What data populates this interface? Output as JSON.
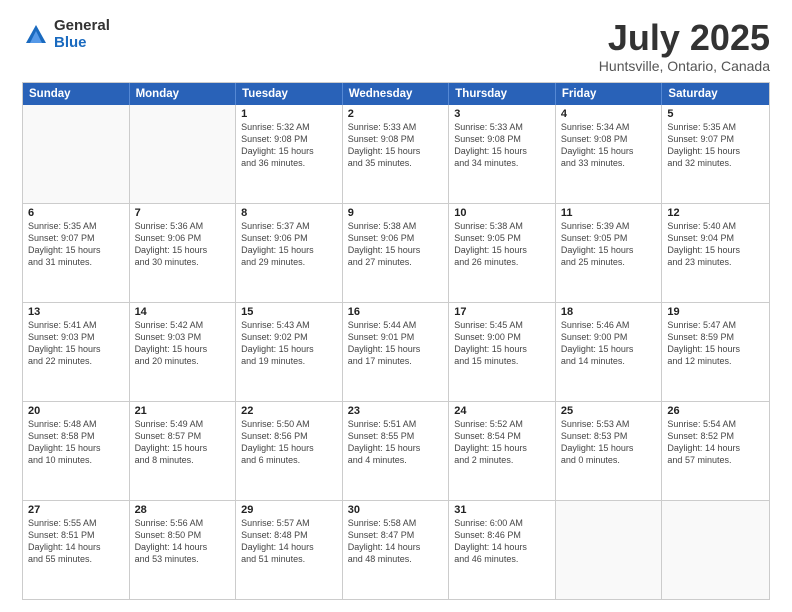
{
  "logo": {
    "general": "General",
    "blue": "Blue"
  },
  "title": "July 2025",
  "location": "Huntsville, Ontario, Canada",
  "header_days": [
    "Sunday",
    "Monday",
    "Tuesday",
    "Wednesday",
    "Thursday",
    "Friday",
    "Saturday"
  ],
  "rows": [
    [
      {
        "day": "",
        "empty": true
      },
      {
        "day": "",
        "empty": true
      },
      {
        "day": "1",
        "lines": [
          "Sunrise: 5:32 AM",
          "Sunset: 9:08 PM",
          "Daylight: 15 hours",
          "and 36 minutes."
        ]
      },
      {
        "day": "2",
        "lines": [
          "Sunrise: 5:33 AM",
          "Sunset: 9:08 PM",
          "Daylight: 15 hours",
          "and 35 minutes."
        ]
      },
      {
        "day": "3",
        "lines": [
          "Sunrise: 5:33 AM",
          "Sunset: 9:08 PM",
          "Daylight: 15 hours",
          "and 34 minutes."
        ]
      },
      {
        "day": "4",
        "lines": [
          "Sunrise: 5:34 AM",
          "Sunset: 9:08 PM",
          "Daylight: 15 hours",
          "and 33 minutes."
        ]
      },
      {
        "day": "5",
        "lines": [
          "Sunrise: 5:35 AM",
          "Sunset: 9:07 PM",
          "Daylight: 15 hours",
          "and 32 minutes."
        ]
      }
    ],
    [
      {
        "day": "6",
        "lines": [
          "Sunrise: 5:35 AM",
          "Sunset: 9:07 PM",
          "Daylight: 15 hours",
          "and 31 minutes."
        ]
      },
      {
        "day": "7",
        "lines": [
          "Sunrise: 5:36 AM",
          "Sunset: 9:06 PM",
          "Daylight: 15 hours",
          "and 30 minutes."
        ]
      },
      {
        "day": "8",
        "lines": [
          "Sunrise: 5:37 AM",
          "Sunset: 9:06 PM",
          "Daylight: 15 hours",
          "and 29 minutes."
        ]
      },
      {
        "day": "9",
        "lines": [
          "Sunrise: 5:38 AM",
          "Sunset: 9:06 PM",
          "Daylight: 15 hours",
          "and 27 minutes."
        ]
      },
      {
        "day": "10",
        "lines": [
          "Sunrise: 5:38 AM",
          "Sunset: 9:05 PM",
          "Daylight: 15 hours",
          "and 26 minutes."
        ]
      },
      {
        "day": "11",
        "lines": [
          "Sunrise: 5:39 AM",
          "Sunset: 9:05 PM",
          "Daylight: 15 hours",
          "and 25 minutes."
        ]
      },
      {
        "day": "12",
        "lines": [
          "Sunrise: 5:40 AM",
          "Sunset: 9:04 PM",
          "Daylight: 15 hours",
          "and 23 minutes."
        ]
      }
    ],
    [
      {
        "day": "13",
        "lines": [
          "Sunrise: 5:41 AM",
          "Sunset: 9:03 PM",
          "Daylight: 15 hours",
          "and 22 minutes."
        ]
      },
      {
        "day": "14",
        "lines": [
          "Sunrise: 5:42 AM",
          "Sunset: 9:03 PM",
          "Daylight: 15 hours",
          "and 20 minutes."
        ]
      },
      {
        "day": "15",
        "lines": [
          "Sunrise: 5:43 AM",
          "Sunset: 9:02 PM",
          "Daylight: 15 hours",
          "and 19 minutes."
        ]
      },
      {
        "day": "16",
        "lines": [
          "Sunrise: 5:44 AM",
          "Sunset: 9:01 PM",
          "Daylight: 15 hours",
          "and 17 minutes."
        ]
      },
      {
        "day": "17",
        "lines": [
          "Sunrise: 5:45 AM",
          "Sunset: 9:00 PM",
          "Daylight: 15 hours",
          "and 15 minutes."
        ]
      },
      {
        "day": "18",
        "lines": [
          "Sunrise: 5:46 AM",
          "Sunset: 9:00 PM",
          "Daylight: 15 hours",
          "and 14 minutes."
        ]
      },
      {
        "day": "19",
        "lines": [
          "Sunrise: 5:47 AM",
          "Sunset: 8:59 PM",
          "Daylight: 15 hours",
          "and 12 minutes."
        ]
      }
    ],
    [
      {
        "day": "20",
        "lines": [
          "Sunrise: 5:48 AM",
          "Sunset: 8:58 PM",
          "Daylight: 15 hours",
          "and 10 minutes."
        ]
      },
      {
        "day": "21",
        "lines": [
          "Sunrise: 5:49 AM",
          "Sunset: 8:57 PM",
          "Daylight: 15 hours",
          "and 8 minutes."
        ]
      },
      {
        "day": "22",
        "lines": [
          "Sunrise: 5:50 AM",
          "Sunset: 8:56 PM",
          "Daylight: 15 hours",
          "and 6 minutes."
        ]
      },
      {
        "day": "23",
        "lines": [
          "Sunrise: 5:51 AM",
          "Sunset: 8:55 PM",
          "Daylight: 15 hours",
          "and 4 minutes."
        ]
      },
      {
        "day": "24",
        "lines": [
          "Sunrise: 5:52 AM",
          "Sunset: 8:54 PM",
          "Daylight: 15 hours",
          "and 2 minutes."
        ]
      },
      {
        "day": "25",
        "lines": [
          "Sunrise: 5:53 AM",
          "Sunset: 8:53 PM",
          "Daylight: 15 hours",
          "and 0 minutes."
        ]
      },
      {
        "day": "26",
        "lines": [
          "Sunrise: 5:54 AM",
          "Sunset: 8:52 PM",
          "Daylight: 14 hours",
          "and 57 minutes."
        ]
      }
    ],
    [
      {
        "day": "27",
        "lines": [
          "Sunrise: 5:55 AM",
          "Sunset: 8:51 PM",
          "Daylight: 14 hours",
          "and 55 minutes."
        ]
      },
      {
        "day": "28",
        "lines": [
          "Sunrise: 5:56 AM",
          "Sunset: 8:50 PM",
          "Daylight: 14 hours",
          "and 53 minutes."
        ]
      },
      {
        "day": "29",
        "lines": [
          "Sunrise: 5:57 AM",
          "Sunset: 8:48 PM",
          "Daylight: 14 hours",
          "and 51 minutes."
        ]
      },
      {
        "day": "30",
        "lines": [
          "Sunrise: 5:58 AM",
          "Sunset: 8:47 PM",
          "Daylight: 14 hours",
          "and 48 minutes."
        ]
      },
      {
        "day": "31",
        "lines": [
          "Sunrise: 6:00 AM",
          "Sunset: 8:46 PM",
          "Daylight: 14 hours",
          "and 46 minutes."
        ]
      },
      {
        "day": "",
        "empty": true
      },
      {
        "day": "",
        "empty": true
      }
    ]
  ]
}
